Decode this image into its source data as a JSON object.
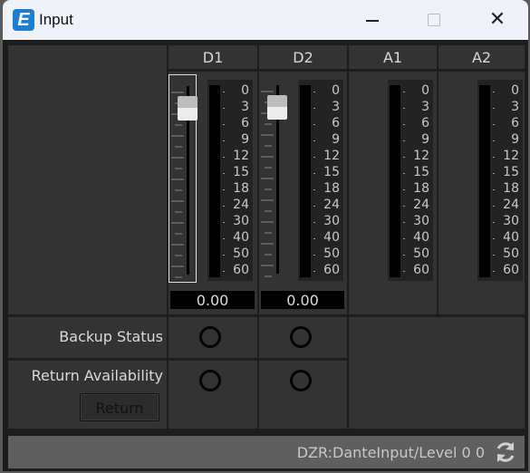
{
  "window": {
    "title": "Input",
    "app_icon_glyph": "E",
    "controls": {
      "minimize": "minimize-icon",
      "maximize": "maximize-icon",
      "close": "close-icon",
      "close_glyph": "✕"
    }
  },
  "channels": [
    {
      "name": "D1",
      "has_fader": true,
      "selected": true,
      "fader_value": "0.00",
      "fader_position_db": 0
    },
    {
      "name": "D2",
      "has_fader": true,
      "selected": false,
      "fader_value": "0.00",
      "fader_position_db": 0
    },
    {
      "name": "A1",
      "has_fader": false
    },
    {
      "name": "A2",
      "has_fader": false
    }
  ],
  "meter_scale": [
    "0",
    "3",
    "6",
    "9",
    "12",
    "15",
    "18",
    "24",
    "30",
    "40",
    "50",
    "60"
  ],
  "rows": {
    "backup_status": {
      "label": "Backup Status",
      "states": [
        "off",
        "off"
      ]
    },
    "return_availability": {
      "label": "Return Availability",
      "states": [
        "off",
        "off"
      ],
      "button_label": "Return"
    }
  },
  "status_bar": {
    "text": "DZR:DanteInput/Level 0 0",
    "refresh_icon": "refresh-icon"
  }
}
